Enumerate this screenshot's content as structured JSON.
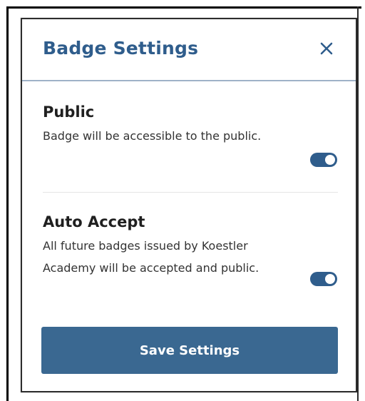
{
  "modal": {
    "title": "Badge Settings",
    "close_icon": "close-icon"
  },
  "settings": [
    {
      "title": "Public",
      "description": "Badge will be accessible to the public.",
      "enabled": true
    },
    {
      "title": "Auto Accept",
      "description": "All future badges issued by Koestler Academy will be accepted and public.",
      "enabled": true
    }
  ],
  "footer": {
    "save_label": "Save Settings"
  },
  "colors": {
    "accent": "#2f5d8c",
    "button": "#3a6891",
    "header_border": "#9fb2c8"
  }
}
